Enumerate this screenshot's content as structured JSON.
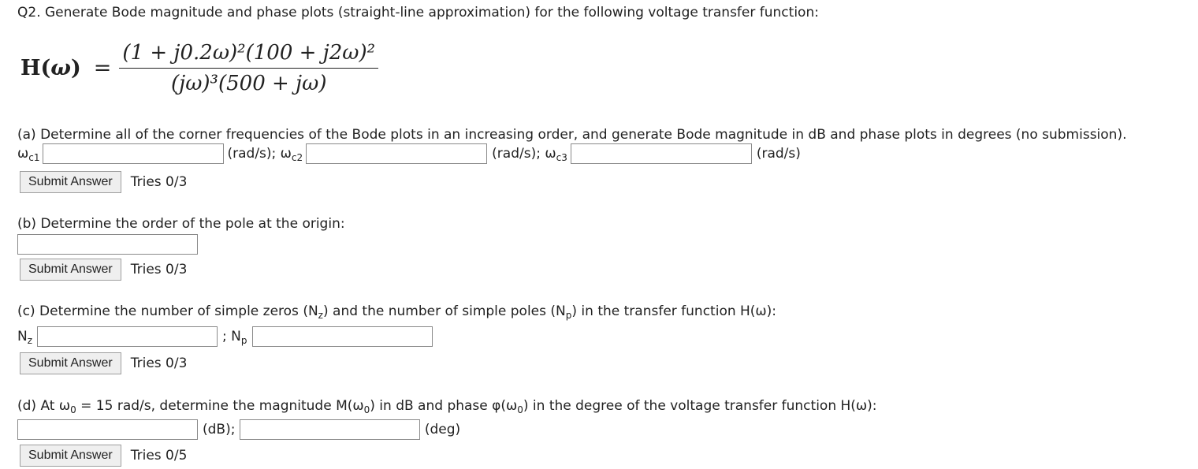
{
  "question": {
    "title": "Q2. Generate Bode magnitude and phase plots (straight-line approximation) for the following voltage transfer function:"
  },
  "formula": {
    "lhs": "H(",
    "lhs_var": "ω",
    "lhs_close": ")",
    "eq": "=",
    "numerator": "(1 + j0.2ω)²(100 + j2ω)²",
    "denominator": "(jω)³(500 + jω)"
  },
  "part_a": {
    "prompt": "(a) Determine all of the corner frequencies of the Bode plots in an increasing order, and generate Bode magnitude in dB and phase plots in degrees (no submission).",
    "label1_main": "ω",
    "label1_sub": "c1",
    "unit1": "(rad/s); ",
    "label2_main": "ω",
    "label2_sub": "c2",
    "unit2": "(rad/s); ",
    "label3_main": "ω",
    "label3_sub": "c3",
    "unit3": "(rad/s)",
    "input1": "",
    "input2": "",
    "input3": "",
    "submit": "Submit Answer",
    "tries": "Tries 0/3"
  },
  "part_b": {
    "prompt": "(b) Determine the order of the pole at the origin:",
    "input": "",
    "submit": "Submit Answer",
    "tries": "Tries 0/3"
  },
  "part_c": {
    "prompt_1": "(c) Determine the number of simple zeros (N",
    "prompt_sub1": "z",
    "prompt_2": ") and the number of simple poles (N",
    "prompt_sub2": "p",
    "prompt_3": ") in the transfer function H(ω):",
    "label1_main": "N",
    "label1_sub": "z",
    "sep": "; N",
    "label2_sub": "p",
    "input1": "",
    "input2": "",
    "submit": "Submit Answer",
    "tries": "Tries 0/3"
  },
  "part_d": {
    "prompt_1": "(d) At ω",
    "prompt_sub0": "0",
    "prompt_2": " = 15 rad/s, determine the magnitude M(ω",
    "prompt_3": ") in dB and phase φ(ω",
    "prompt_4": ") in the degree of the voltage transfer function H(ω):",
    "unit1": "(dB); ",
    "unit2": "(deg)",
    "input1": "",
    "input2": "",
    "submit": "Submit Answer",
    "tries": "Tries 0/5"
  }
}
